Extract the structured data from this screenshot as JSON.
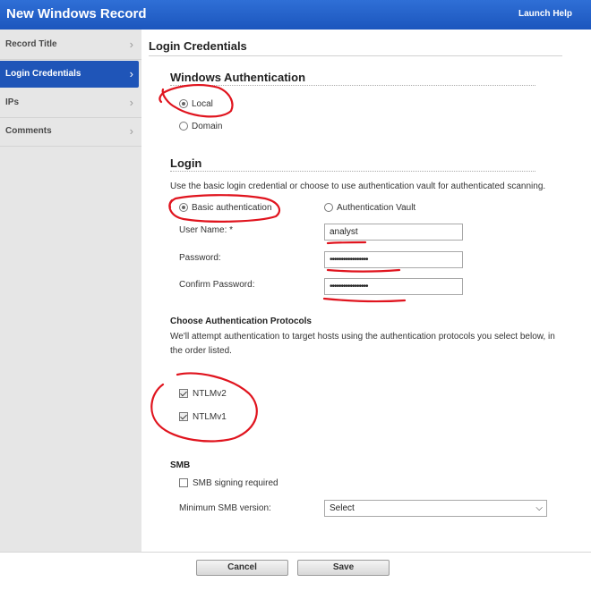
{
  "window": {
    "title": "New Windows Record",
    "help_link": "Launch Help"
  },
  "sidebar": {
    "items": [
      {
        "label": "Record Title",
        "active": false
      },
      {
        "label": "Login Credentials",
        "active": true
      },
      {
        "label": "IPs",
        "active": false
      },
      {
        "label": "Comments",
        "active": false
      }
    ]
  },
  "main": {
    "page_title": "Login Credentials",
    "windows_auth": {
      "title": "Windows Authentication",
      "options": [
        {
          "label": "Local",
          "selected": true
        },
        {
          "label": "Domain",
          "selected": false
        }
      ]
    },
    "login": {
      "title": "Login",
      "description": "Use the basic login credential or choose to use authentication vault for authenticated scanning.",
      "basic_auth_label": "Basic authentication",
      "basic_auth_selected": true,
      "vault_label": "Authentication Vault",
      "vault_selected": false,
      "username_label": "User Name: *",
      "username_value": "analyst",
      "password_label": "Password:",
      "password_value": "•••••••••••••••••",
      "confirm_label": "Confirm Password:",
      "confirm_value": "•••••••••••••••••"
    },
    "protocols": {
      "title": "Choose Authentication Protocols",
      "description_line1": "We'll attempt authentication to target hosts using the authentication protocols you select below, in",
      "description_line2": "the order listed.",
      "items": [
        {
          "label": "NTLMv2",
          "checked": true
        },
        {
          "label": "NTLMv1",
          "checked": true
        }
      ]
    },
    "smb": {
      "title": "SMB",
      "signing_label": "SMB signing required",
      "signing_checked": false,
      "min_version_label": "Minimum SMB version:",
      "min_version_value": "Select"
    }
  },
  "footer": {
    "cancel_label": "Cancel",
    "save_label": "Save"
  },
  "colors": {
    "header_blue": "#1f55b8",
    "annotation_red": "#e0141e",
    "sidebar_bg": "#e6e6e6"
  }
}
